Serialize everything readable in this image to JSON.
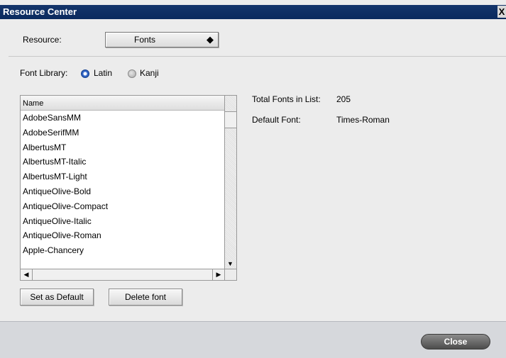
{
  "window": {
    "title": "Resource Center",
    "close_glyph": "X"
  },
  "resource": {
    "label": "Resource:",
    "selected": "Fonts",
    "arrows": "⬍"
  },
  "font_library": {
    "label": "Font Library:",
    "options": [
      {
        "label": "Latin",
        "selected": true
      },
      {
        "label": "Kanji",
        "selected": false
      }
    ]
  },
  "list": {
    "header": "Name",
    "items": [
      "AdobeSansMM",
      "AdobeSerifMM",
      "AlbertusMT",
      "AlbertusMT-Italic",
      "AlbertusMT-Light",
      "AntiqueOlive-Bold",
      "AntiqueOlive-Compact",
      "AntiqueOlive-Italic",
      "AntiqueOlive-Roman",
      "Apple-Chancery"
    ]
  },
  "info": {
    "total_label": "Total Fonts in List:",
    "total_value": "205",
    "default_label": "Default Font:",
    "default_value": "Times-Roman"
  },
  "buttons": {
    "set_default": "Set as Default",
    "delete_font": "Delete font",
    "close": "Close"
  },
  "colors": {
    "titlebar": "#0a2a5e",
    "selected_radio": "#1f4fa8",
    "close_button": "#4c4c4c"
  }
}
